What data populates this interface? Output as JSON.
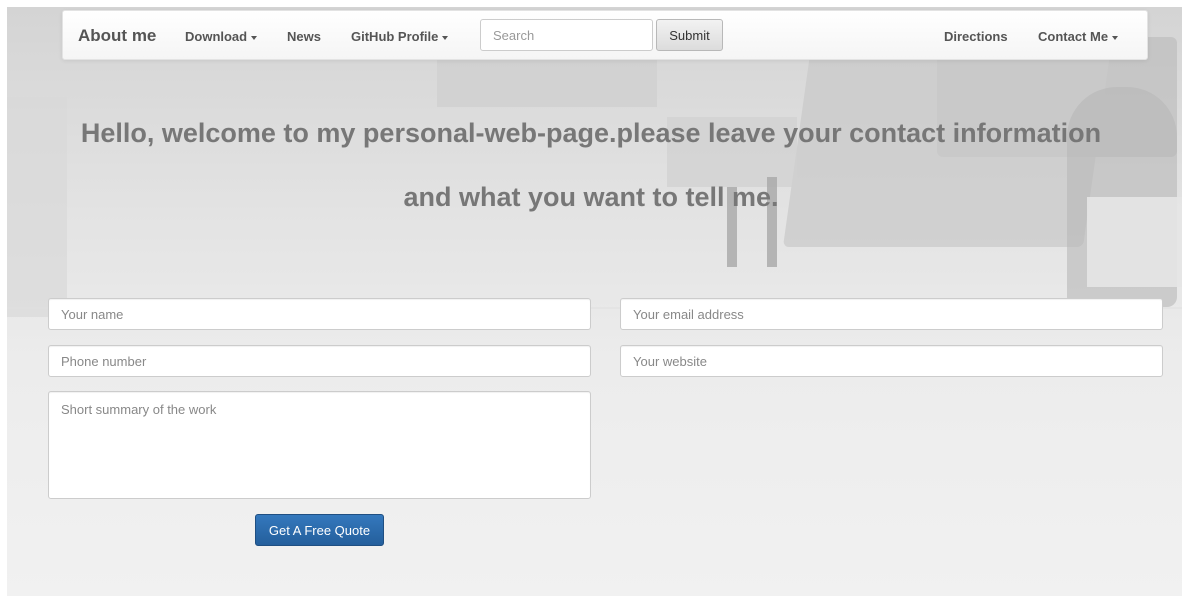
{
  "navbar": {
    "brand": "About me",
    "items": [
      {
        "label": "Download",
        "dropdown": true
      },
      {
        "label": "News",
        "dropdown": false
      },
      {
        "label": "GitHub Profile",
        "dropdown": true
      }
    ],
    "search": {
      "placeholder": "Search",
      "value": ""
    },
    "submit_label": "Submit",
    "right_items": [
      {
        "label": "Directions",
        "dropdown": false
      },
      {
        "label": "Contact Me",
        "dropdown": true
      }
    ]
  },
  "hero": {
    "line1": "Hello, welcome to my personal-web-page.please leave your contact information",
    "line2": "and what you want to tell me."
  },
  "form": {
    "name_placeholder": "Your name",
    "email_placeholder": "Your email address",
    "phone_placeholder": "Phone number",
    "website_placeholder": "Your website",
    "summary_placeholder": "Short summary of the work",
    "submit_label": "Get A Free Quote"
  },
  "colors": {
    "primary_button": "#2a6aad",
    "text_muted": "#777777"
  }
}
